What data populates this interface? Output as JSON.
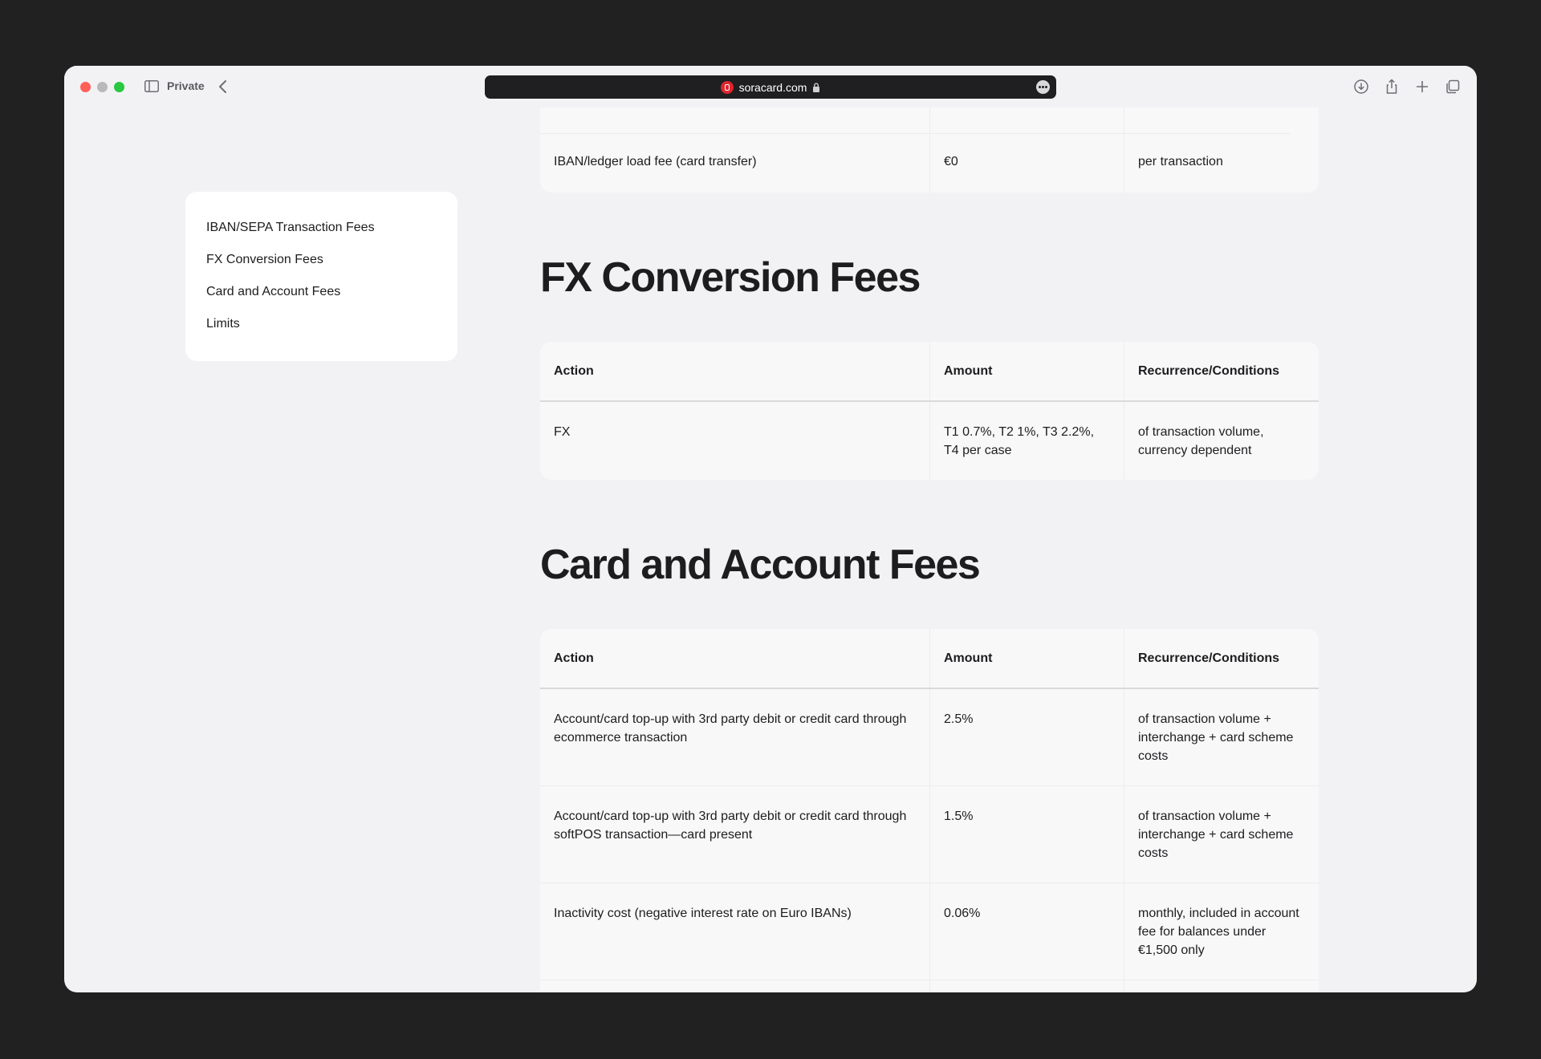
{
  "browser": {
    "mode_label": "Private",
    "url": "soracard.com"
  },
  "toc": {
    "items": [
      {
        "label": "IBAN/SEPA Transaction Fees"
      },
      {
        "label": "FX Conversion Fees"
      },
      {
        "label": "Card and Account Fees"
      },
      {
        "label": "Limits"
      }
    ]
  },
  "prev_table": {
    "partial_row": {
      "action": "",
      "amount": "",
      "recurrence": ""
    },
    "rows": [
      {
        "action": "IBAN/ledger load fee (card transfer)",
        "amount": "€0",
        "recurrence": "per transaction"
      }
    ]
  },
  "fx": {
    "heading": "FX Conversion Fees",
    "headers": {
      "action": "Action",
      "amount": "Amount",
      "recurrence": "Recurrence/Conditions"
    },
    "rows": [
      {
        "action": "FX",
        "amount": "T1 0.7%, T2 1%, T3 2.2%, T4 per case",
        "recurrence": "of transaction volume, currency dependent"
      }
    ]
  },
  "card": {
    "heading": "Card and Account Fees",
    "headers": {
      "action": "Action",
      "amount": "Amount",
      "recurrence": "Recurrence/Conditions"
    },
    "rows": [
      {
        "action": "Account/card top-up with 3rd party debit or credit card through ecommerce transaction",
        "amount": "2.5%",
        "recurrence": "of transaction volume + interchange + card scheme costs"
      },
      {
        "action": "Account/card top-up with 3rd party debit or credit card through softPOS transaction—card present",
        "amount": "1.5%",
        "recurrence": "of transaction volume + interchange + card scheme costs"
      },
      {
        "action": "Inactivity cost (negative interest rate on Euro IBANs)",
        "amount": "0.06%",
        "recurrence": "monthly, included in account fee for balances under €1,500 only"
      }
    ]
  }
}
